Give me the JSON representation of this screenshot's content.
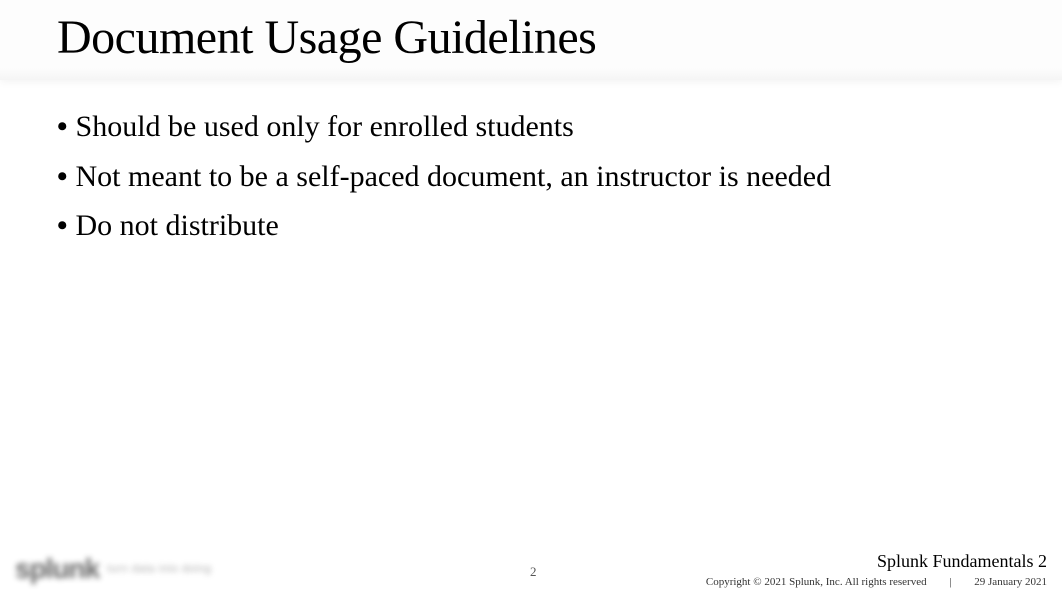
{
  "header": {
    "title": "Document Usage Guidelines"
  },
  "content": {
    "bullets": [
      "Should be used only for enrolled students",
      "Not meant to be a self-paced document, an instructor is needed",
      "Do not distribute"
    ]
  },
  "footer": {
    "logo": "splunk",
    "tagline": "turn data into doing",
    "page_number": "2",
    "course_name": "Splunk Fundamentals 2",
    "copyright": "Copyright © 2021 Splunk, Inc. All rights reserved",
    "divider": "|",
    "date": "29 January 2021"
  }
}
